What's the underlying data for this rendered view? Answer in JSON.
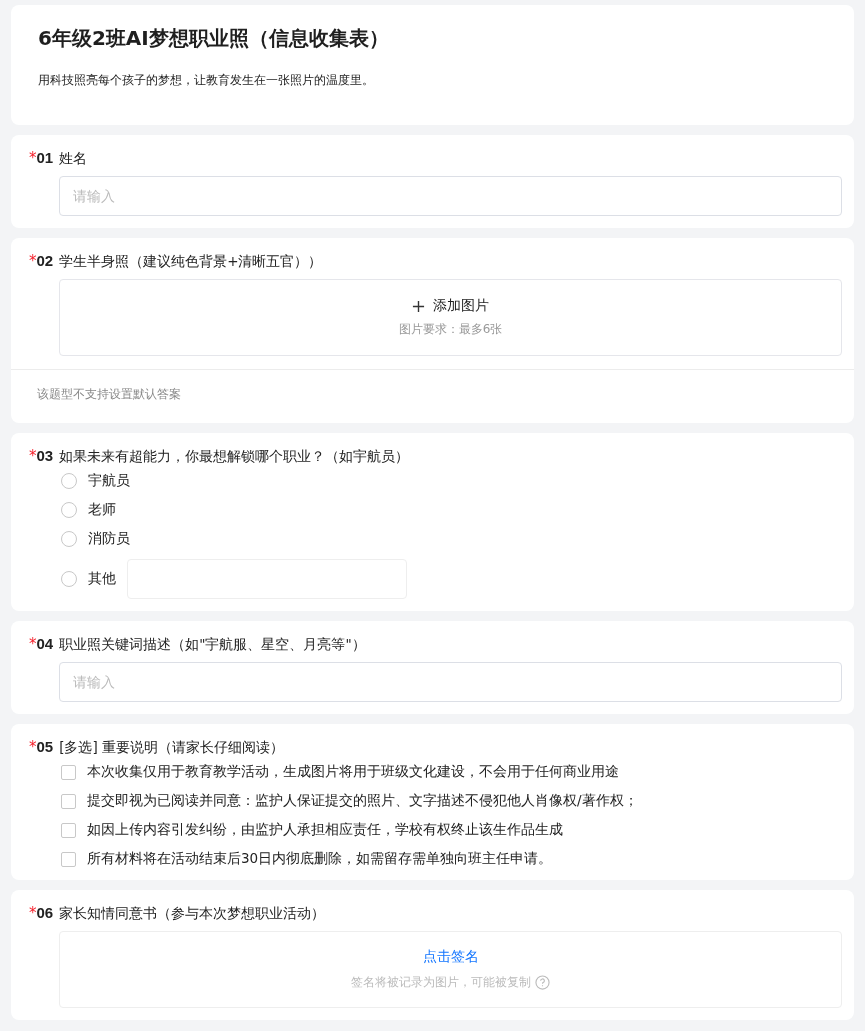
{
  "header": {
    "title": "6年级2班AI梦想职业照（信息收集表）",
    "description": "用科技照亮每个孩子的梦想，让教育发生在一张照片的温度里。"
  },
  "questions": [
    {
      "kind": "text",
      "required_mark": "*",
      "number": "01",
      "title": "姓名",
      "placeholder": "请输入"
    },
    {
      "kind": "upload",
      "required_mark": "*",
      "number": "02",
      "title": "学生半身照（建议纯色背景+清晰五官））",
      "upload_label": "添加图片",
      "upload_hint": "图片要求：最多6张",
      "note": "该题型不支持设置默认答案"
    },
    {
      "kind": "radio",
      "required_mark": "*",
      "number": "03",
      "title": "如果未来有超能力，你最想解锁哪个职业？（如宇航员）",
      "options": [
        {
          "label": "宇航员",
          "selected": false,
          "kind": "plain"
        },
        {
          "label": "老师",
          "selected": false,
          "kind": "plain"
        },
        {
          "label": "消防员",
          "selected": false,
          "kind": "plain"
        },
        {
          "label": "其他",
          "selected": false,
          "kind": "with_input"
        }
      ]
    },
    {
      "kind": "text",
      "required_mark": "*",
      "number": "04",
      "title": "职业照关键词描述（如\"宇航服、星空、月亮等\"）",
      "placeholder": "请输入"
    },
    {
      "kind": "checkbox",
      "required_mark": "*",
      "number": "05",
      "title": "[多选] 重要说明（请家长仔细阅读）",
      "options": [
        {
          "label": "本次收集仅用于教育教学活动，生成图片将用于班级文化建设，不会用于任何商业用途",
          "checked": false
        },
        {
          "label": "提交即视为已阅读并同意：监护人保证提交的照片、文字描述不侵犯他人肖像权/著作权；",
          "checked": false
        },
        {
          "label": "如因上传内容引发纠纷，由监护人承担相应责任，学校有权终止该生作品生成",
          "checked": false
        },
        {
          "label": "所有材料将在活动结束后30日内彻底删除，如需留存需单独向班主任申请。",
          "checked": false
        }
      ]
    },
    {
      "kind": "signature",
      "required_mark": "*",
      "number": "06",
      "title": "家长知情同意书（参与本次梦想职业活动）",
      "sign_label": "点击签名",
      "sign_hint": "签名将被记录为图片，可能被复制"
    }
  ]
}
